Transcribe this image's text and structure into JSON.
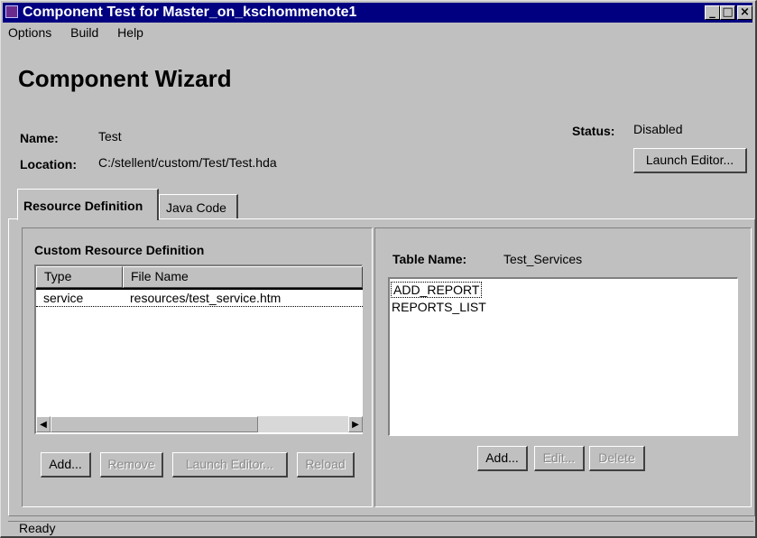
{
  "window": {
    "title": "Component Test for Master_on_kschommenote1",
    "controls": {
      "minimize": "_",
      "maximize": "□",
      "close": "×"
    }
  },
  "menu": {
    "items": [
      "Options",
      "Build",
      "Help"
    ]
  },
  "heading": "Component Wizard",
  "info": {
    "name_label": "Name:",
    "name_value": "Test",
    "location_label": "Location:",
    "location_value": "C:/stellent/custom/Test/Test.hda",
    "status_label": "Status:",
    "status_value": "Disabled",
    "launch_editor_label": "Launch Editor..."
  },
  "tabs": [
    {
      "label": "Resource Definition",
      "selected": true
    },
    {
      "label": "Java Code",
      "selected": false
    }
  ],
  "left_panel": {
    "title": "Custom Resource Definition",
    "columns": [
      "Type",
      "File Name"
    ],
    "rows": [
      {
        "type": "service",
        "file": "resources/test_service.htm"
      }
    ],
    "buttons": [
      "Add...",
      "Remove",
      "Launch Editor...",
      "Reload"
    ]
  },
  "right_panel": {
    "table_name_label": "Table Name:",
    "table_name_value": "Test_Services",
    "items": [
      "ADD_REPORT",
      "REPORTS_LIST"
    ],
    "buttons": [
      "Add...",
      "Edit...",
      "Delete"
    ]
  },
  "status_bar": "Ready",
  "colors": {
    "titlebar": "#000080",
    "face": "#c0c0c0",
    "app_icon": "#6a2c8c"
  }
}
